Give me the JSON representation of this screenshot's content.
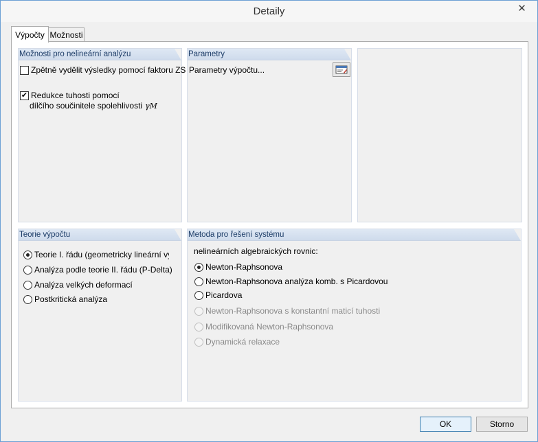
{
  "window": {
    "title": "Detaily",
    "close_icon": "close-icon"
  },
  "tabs": [
    {
      "label": "Výpočty"
    },
    {
      "label": "Možnosti"
    }
  ],
  "nonlinear": {
    "header": "Možnosti pro nelineární analýzu",
    "zs_label": "Zpětně vydělit výsledky pomocí faktoru ZS",
    "zs_checked": false,
    "reduce_line1": "Redukce tuhosti pomocí",
    "reduce_line2": "dílčího součinitele spolehlivosti",
    "gamma": "γM",
    "reduce_checked": true
  },
  "params": {
    "header": "Parametry",
    "label": "Parametry výpočtu...",
    "icon": "edit-params-icon"
  },
  "theory": {
    "header": "Teorie výpočtu",
    "options": [
      {
        "label": "Teorie I. řádu (geometricky lineární výp.)",
        "selected": true
      },
      {
        "label": "Analýza podle teorie II. řádu (P-Delta)",
        "selected": false
      },
      {
        "label": "Analýza velkých deformací",
        "selected": false
      },
      {
        "label": "Postkritická analýza",
        "selected": false
      }
    ]
  },
  "method": {
    "header": "Metoda pro řešení systému",
    "intro": "nelineárních algebraických rovnic:",
    "options": [
      {
        "label": "Newton-Raphsonova",
        "selected": true,
        "enabled": true
      },
      {
        "label": "Newton-Raphsonova analýza komb. s Picardovou",
        "selected": false,
        "enabled": true
      },
      {
        "label": "Picardova",
        "selected": false,
        "enabled": true
      },
      {
        "label": "Newton-Raphsonova s konstantní maticí tuhosti",
        "selected": false,
        "enabled": false
      },
      {
        "label": "Modifikovaná Newton-Raphsonova",
        "selected": false,
        "enabled": false
      },
      {
        "label": "Dynamická relaxace",
        "selected": false,
        "enabled": false
      }
    ]
  },
  "buttons": {
    "ok": "OK",
    "cancel": "Storno"
  }
}
